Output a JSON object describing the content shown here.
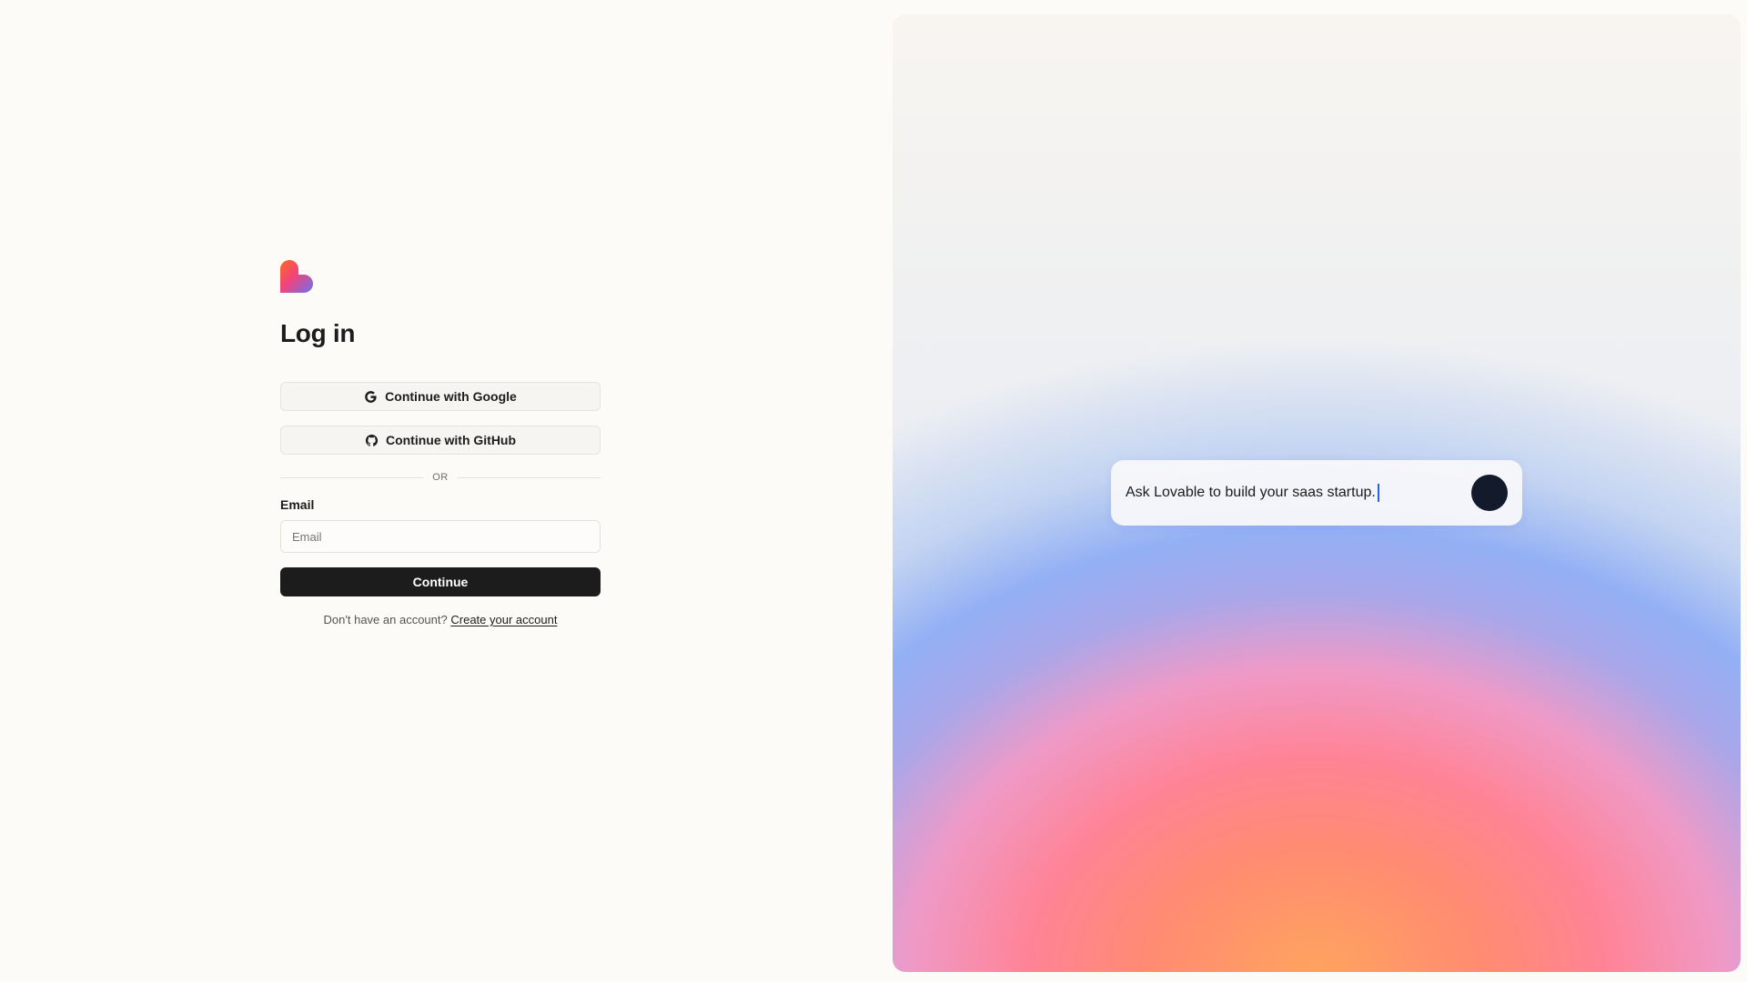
{
  "login": {
    "title": "Log in",
    "google_button": "Continue with Google",
    "github_button": "Continue with GitHub",
    "divider_text": "OR",
    "email_label": "Email",
    "email_placeholder": "Email",
    "email_value": "",
    "continue_button": "Continue",
    "signup_prompt": "Don't have an account?",
    "signup_link": "Create your account"
  },
  "hero": {
    "prompt_text": "Ask Lovable to build your saas startup."
  },
  "icons": {
    "logo": "lovable-heart-logo",
    "google": "google-icon",
    "github": "github-icon",
    "send": "send-button"
  },
  "colors": {
    "page_background": "#fcfbf8",
    "primary_button": "#1c1c1c",
    "send_button": "#121a2b",
    "caret": "#2a66d8"
  }
}
